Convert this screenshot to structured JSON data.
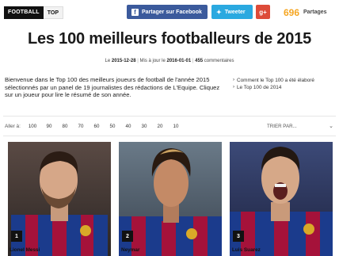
{
  "header": {
    "logo_left": "FOOTBALL",
    "logo_right": "TOP",
    "facebook_label": "Partager sur Facebook",
    "twitter_label": "Tweeter",
    "gplus_label": "g+",
    "share_count": "696",
    "share_label": "Partages"
  },
  "article": {
    "title": "Les 100 meilleurs footballeurs de 2015",
    "meta_le": "Le",
    "date": "2015-12-28",
    "updated_label": "Mis à jour le",
    "updated": "2016-01-01",
    "comments_count": "455",
    "comments_label": "commentaires",
    "intro": "Bienvenue dans le Top 100 des meilleurs joueurs de football de l'année 2015 sélectionnés par un panel de 19 journalistes des rédactions de L'Equipe. Cliquez sur un joueur pour lire le résumé de son année."
  },
  "side_links": [
    "Comment le Top 100 a été élaboré",
    "Le Top 100 de 2014"
  ],
  "nav": {
    "aller_label": "Aller à:",
    "numbers": [
      "100",
      "90",
      "80",
      "70",
      "60",
      "50",
      "40",
      "30",
      "20",
      "10"
    ],
    "sort_label": "TRIER PAR..."
  },
  "players": [
    {
      "rank": "1",
      "name": "Lionel Messi"
    },
    {
      "rank": "2",
      "name": "Neymar"
    },
    {
      "rank": "3",
      "name": "Luis Suarez"
    }
  ],
  "colors": {
    "facebook": "#3b5a9c",
    "twitter": "#2aa9e0",
    "gplus": "#dd4b39",
    "share_count": "#f5a623",
    "barca_blue": "#1b3b8c",
    "barca_red": "#a5123a"
  }
}
